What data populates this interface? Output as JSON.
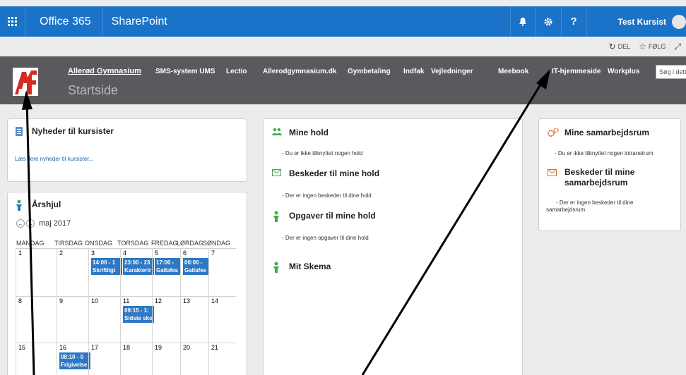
{
  "suitebar": {
    "brand": "Office 365",
    "app_name": "SharePoint",
    "user_name": "Test Kursist"
  },
  "actionbar": {
    "share_label": "DEL",
    "follow_label": "FØLG"
  },
  "site": {
    "title": "Allerød Gymnasium",
    "subtitle": "Startside",
    "nav": [
      "SMS-system UMS",
      "Lectio",
      "Allerodgymnasium.dk",
      "Gymbetaling",
      "Indfak",
      "Vejledninger",
      "Meebook",
      "IT-hjemmeside",
      "Workplus"
    ],
    "search_placeholder": "Søg i dette"
  },
  "news": {
    "title": "Nyheder til kursister",
    "more_link": "Læs flere nyheder til kursister..."
  },
  "calendar": {
    "title": "Årshjul",
    "month": "maj 2017",
    "weekdays": [
      "MANDAG",
      "TIRSDAG",
      "ONSDAG",
      "TORSDAG",
      "FREDAG",
      "LØRDAG",
      "SØNDAG"
    ],
    "weeks": [
      {
        "days": [
          "1",
          "2",
          "3",
          "4",
          "5",
          "6",
          "7"
        ]
      },
      {
        "days": [
          "8",
          "9",
          "10",
          "11",
          "12",
          "13",
          "14"
        ]
      },
      {
        "days": [
          "15",
          "16",
          "17",
          "18",
          "19",
          "20",
          "21"
        ]
      }
    ],
    "events": [
      {
        "time": "14:00 - 1",
        "title": "Skriftligt"
      },
      {
        "time": "23:00 - 23",
        "title": "Karakterir"
      },
      {
        "time": "17:00 -",
        "title": "Gallafes"
      },
      {
        "time": "00:00 -",
        "title": "Gallafes"
      },
      {
        "time": "09:15 - 1:",
        "title": "Sidste sko"
      },
      {
        "time": "08:10 - 0",
        "title": "Frigivelse"
      }
    ]
  },
  "mine_hold": {
    "title": "Mine hold",
    "text": "- Du er ikke tilknyttet nogen hold",
    "messages_title": "Beskeder til mine hold",
    "messages_text": "- Der er ingen beskeder til dine hold",
    "tasks_title": "Opgaver til mine hold",
    "tasks_text": "- Der er ingen opgaver til dine hold",
    "schedule_title": "Mit Skema"
  },
  "samarbejd": {
    "title": "Mine samarbejdsrum",
    "text": "- Du er ikke tilknyttet nogen intranetrum",
    "messages_title_1": "Beskeder til mine",
    "messages_title_2": "samarbejdsrum",
    "messages_text_1": "- Der er ingen beskeder til dine",
    "messages_text_2": "samarbejdsrum"
  },
  "colors": {
    "suitebar": "#1a73c9",
    "header": "#585a5e",
    "event": "#2e79c4",
    "green_icon": "#3cae49",
    "orange_icon": "#e26c35"
  }
}
